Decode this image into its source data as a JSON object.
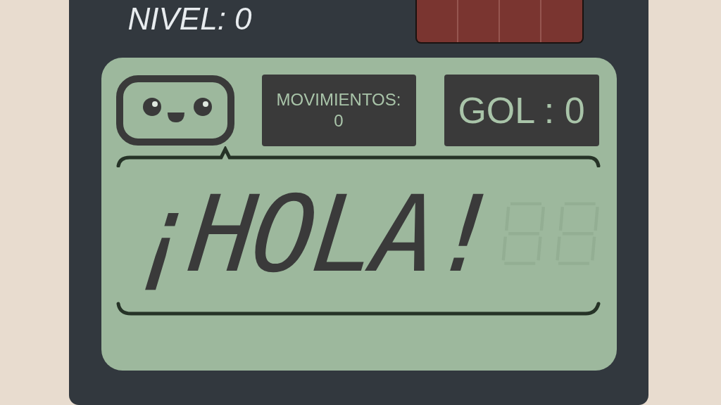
{
  "header": {
    "level_text": "NIVEL: 0"
  },
  "lcd": {
    "moves": {
      "label": "MOVIMIENTOS:",
      "value": "0"
    },
    "goal": "GOL : 0",
    "message": "¡HOLA!"
  }
}
